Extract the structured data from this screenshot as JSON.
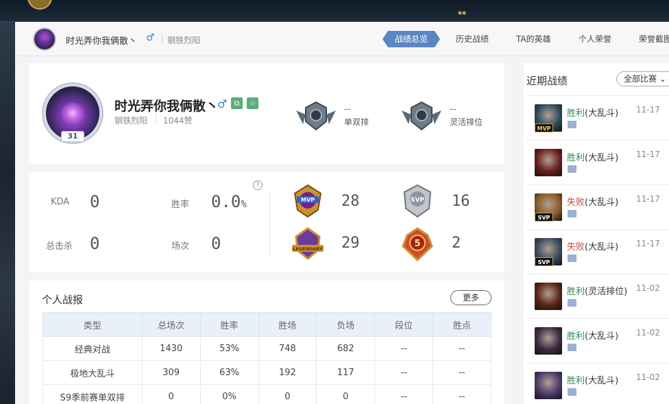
{
  "header": {
    "name": "时光弄你我俩散丶",
    "gender_icon": "male-icon",
    "server": "钢铁烈阳",
    "tabs": [
      {
        "label": "战绩总览",
        "active": true
      },
      {
        "label": "历史战绩",
        "active": false
      },
      {
        "label": "TA的英雄",
        "active": false
      },
      {
        "label": "个人荣誉",
        "active": false
      },
      {
        "label": "荣誉截图",
        "active": false
      }
    ]
  },
  "profile": {
    "name": "时光弄你我俩散丶",
    "level": "31",
    "server": "钢铁烈阳",
    "likes": "1044赞",
    "ranks": [
      {
        "value": "--",
        "label": "单双排"
      },
      {
        "value": "--",
        "label": "灵活排位"
      }
    ]
  },
  "stats": {
    "kda_label": "KDA",
    "kda_value": "0",
    "winrate_label": "胜率",
    "winrate_value": "0.0",
    "winrate_unit": "%",
    "kills_label": "总击杀",
    "kills_value": "0",
    "games_label": "场次",
    "games_value": "0",
    "help_icon": "question-icon",
    "badges": [
      {
        "name": "MVP",
        "count": "28"
      },
      {
        "name": "SVP",
        "count": "16"
      },
      {
        "name": "LEGENDARY",
        "count": "29"
      },
      {
        "name": "5",
        "count": "2"
      }
    ]
  },
  "report": {
    "title": "个人战报",
    "more_label": "更多",
    "columns": [
      "类型",
      "总场次",
      "胜率",
      "胜场",
      "负场",
      "段位",
      "胜点"
    ],
    "rows": [
      [
        "经典对战",
        "1430",
        "53%",
        "748",
        "682",
        "--",
        "--"
      ],
      [
        "极地大乱斗",
        "309",
        "63%",
        "192",
        "117",
        "--",
        "--"
      ],
      [
        "S9季前赛单双排",
        "0",
        "0%",
        "0",
        "0",
        "--",
        "--"
      ]
    ]
  },
  "recent": {
    "title": "近期战绩",
    "filter_label": "全部比赛",
    "matches": [
      {
        "result": "胜利",
        "win": true,
        "mode": "(大乱斗)",
        "date": "11-17",
        "tag": "MVP",
        "champ_color": "#2d4a5a"
      },
      {
        "result": "胜利",
        "win": true,
        "mode": "(大乱斗)",
        "date": "11-17",
        "tag": "",
        "champ_color": "#6a1e1e"
      },
      {
        "result": "失败",
        "win": false,
        "mode": "(大乱斗)",
        "date": "11-17",
        "tag": "SVP",
        "champ_color": "#8a5a2a"
      },
      {
        "result": "失败",
        "win": false,
        "mode": "(大乱斗)",
        "date": "11-17",
        "tag": "SVP",
        "champ_color": "#3a4a5e"
      },
      {
        "result": "胜利",
        "win": true,
        "mode": "(灵活排位)",
        "date": "11-02",
        "tag": "",
        "champ_color": "#5a2418"
      },
      {
        "result": "胜利",
        "win": true,
        "mode": "(大乱斗)",
        "date": "11-02",
        "tag": "",
        "champ_color": "#3a2a40"
      },
      {
        "result": "胜利",
        "win": true,
        "mode": "(大乱斗)",
        "date": "11-02",
        "tag": "",
        "champ_color": "#4a3a6a"
      }
    ]
  }
}
